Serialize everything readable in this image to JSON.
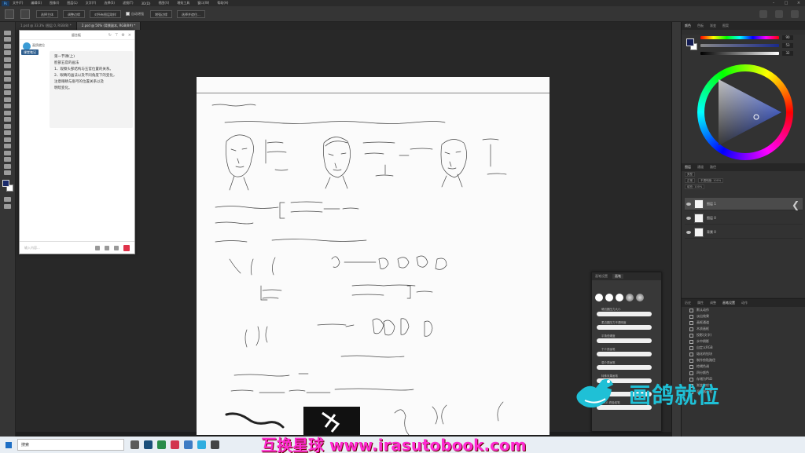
{
  "menubar": {
    "app": "Ps",
    "items": [
      "文件(F)",
      "编辑(E)",
      "图像(I)",
      "图层(L)",
      "文字(Y)",
      "选择(S)",
      "滤镜(T)",
      "3D(D)",
      "视图(V)",
      "增效工具",
      "窗口(W)",
      "帮助(H)"
    ]
  },
  "options": {
    "buttons": [
      "选择主体",
      "调整边缘",
      "对所有图层取样",
      "增强边缘",
      "选择并遮住..."
    ],
    "check_label": "自动增强"
  },
  "tabs": [
    {
      "label": "1.psd @ 33.3% (图层 0, RGB/8) *"
    },
    {
      "label": "2.psd @ 50% (背景副本, RGB/8#) *"
    }
  ],
  "note": {
    "title": "留言板",
    "sender": "画鸽就位",
    "tag": "课堂笔记",
    "lines": [
      "第一节课(上)",
      "脸部五官的画法",
      "1、观察头部结构与五官位置的关系。",
      "2、眼睛的画法以及不同角度下的变化，",
      "注意眼睛与眉弓的位置关系以及",
      "明暗变化。"
    ],
    "input_placeholder": "输入内容..."
  },
  "color_panel": {
    "tabs": [
      "颜色",
      "色板",
      "渐变",
      "图案"
    ],
    "values": [
      "90",
      "53",
      "32"
    ]
  },
  "layers_panel": {
    "tabs": [
      "图层",
      "通道",
      "路径"
    ],
    "kind_label": "类型",
    "blend_mode": "正常",
    "opacity_label": "不透明度: 100%",
    "fill_label": "填充: 100%",
    "layers": [
      "图层 1",
      "图层 0",
      "背景 0"
    ]
  },
  "actions_panel": {
    "tabs": [
      "历史",
      "属性",
      "调整",
      "画笔设置",
      "动作"
    ],
    "items": [
      "默认动作",
      "淡出效果",
      "画框通道",
      "木质画框",
      "投影(文字)",
      "水中倒影",
      "自定义RGB",
      "熔化的铅块",
      "制作剪贴路径",
      "棕褐色调",
      "四分颜色",
      "存储为PSD",
      "渐变映射",
      "混合器画笔"
    ]
  },
  "brush_panel": {
    "tabs": [
      "画笔设置",
      "画笔"
    ],
    "strokes": [
      "硬边圆压力大小",
      "柔边圆压力不透明度",
      "平角低硬度",
      "干介质画笔",
      "湿介质画笔",
      "特殊效果画笔",
      "铅笔",
      "KYLE 终极炭笔"
    ]
  },
  "taskbar": {
    "search_text": "搜索"
  },
  "watermark": {
    "bottom": "互换星球 www.irasutobook.com",
    "brand": "画鸽就位"
  }
}
